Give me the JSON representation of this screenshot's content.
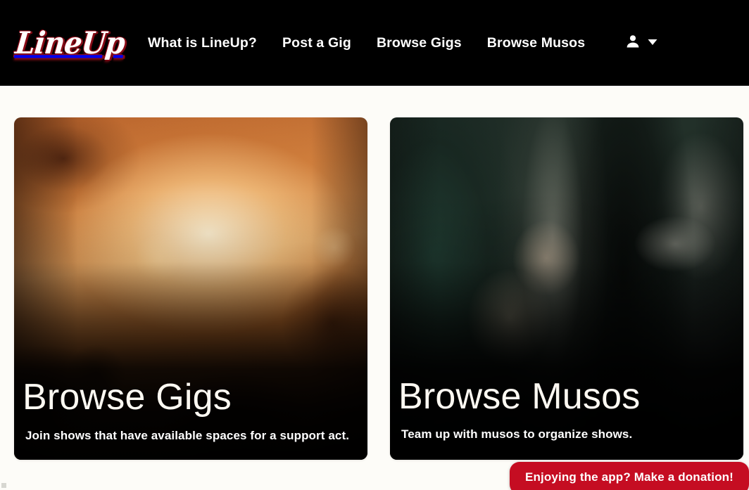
{
  "brand": {
    "logo_text": "LineUp",
    "accent_red": "#c50d22",
    "nav_background": "#000000",
    "page_background": "#fdfcf8"
  },
  "navbar": {
    "links": [
      {
        "label": "What is LineUp?",
        "name": "nav-what-is-lineup"
      },
      {
        "label": "Post a Gig",
        "name": "nav-post-a-gig"
      },
      {
        "label": "Browse Gigs",
        "name": "nav-browse-gigs"
      },
      {
        "label": "Browse Musos",
        "name": "nav-browse-musos"
      }
    ],
    "account": {
      "icon": "person-icon",
      "caret": "chevron-down-icon"
    }
  },
  "main": {
    "cards": [
      {
        "title": "Browse Gigs",
        "description": "Join shows that have available spaces for a support act.",
        "image": "concert-crowd-photo"
      },
      {
        "title": "Browse Musos",
        "description": "Team up with musos to organize shows.",
        "image": "street-musicians-photo"
      }
    ]
  },
  "donation": {
    "label": "Enjoying the app? Make a donation!"
  }
}
